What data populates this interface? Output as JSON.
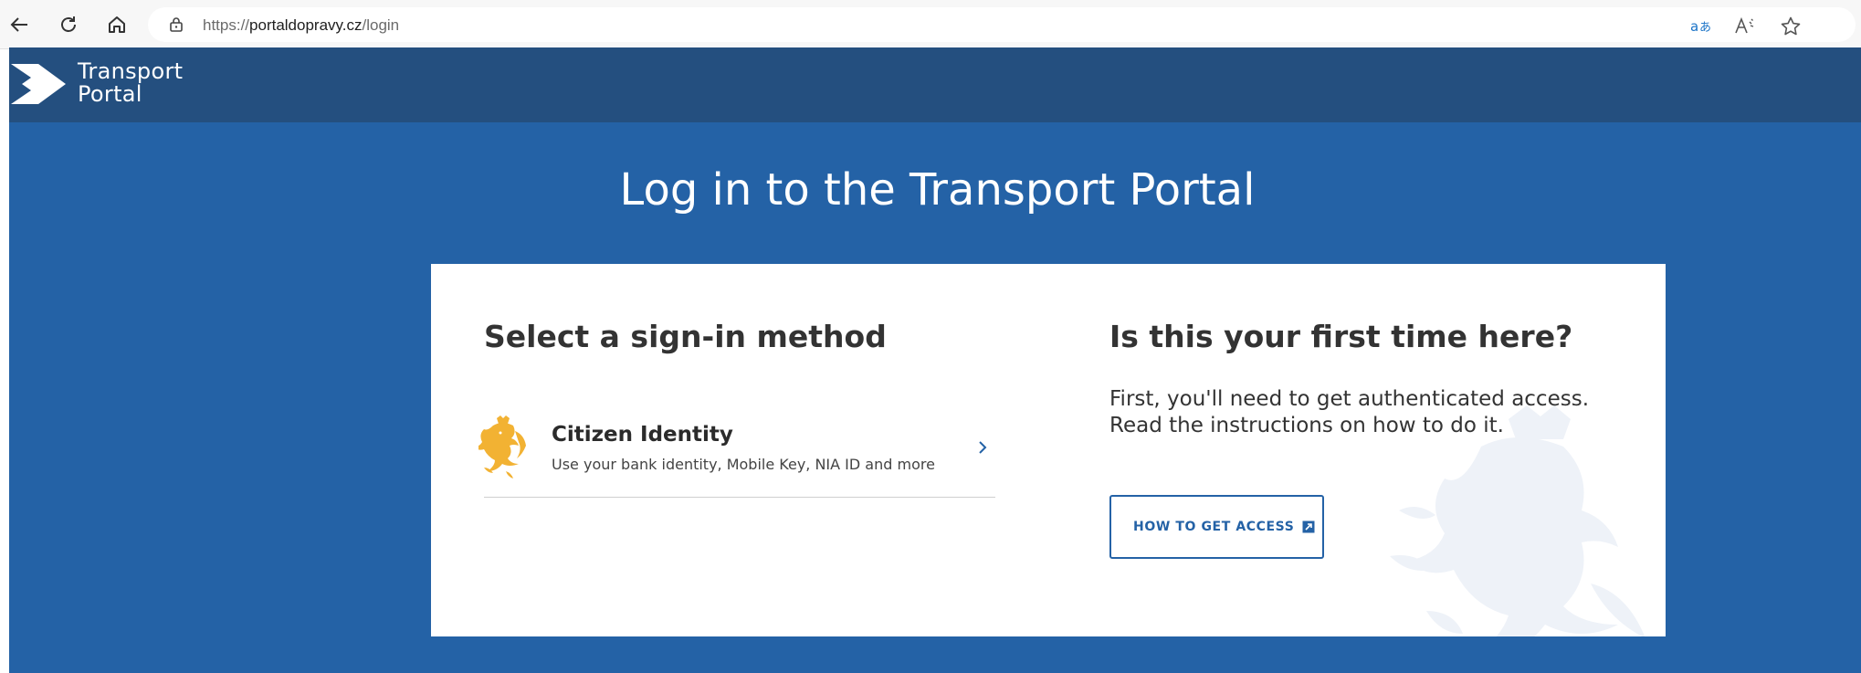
{
  "browser": {
    "url_scheme": "https://",
    "url_host": "portaldopravy.cz",
    "url_path": "/login"
  },
  "header": {
    "logo_line1": "Transport",
    "logo_line2": "Portal"
  },
  "page_title": "Log in to the Transport Portal",
  "sign_in": {
    "title": "Select a sign-in method",
    "methods": [
      {
        "name": "Citizen Identity",
        "description": "Use your bank identity, Mobile Key, NIA ID and more"
      }
    ]
  },
  "first_time": {
    "title": "Is this your first time here?",
    "text": "First, you'll need to get authenticated access. Read the instructions on how to do it.",
    "button_label": "HOW TO GET ACCESS"
  },
  "colors": {
    "header_bg": "#244f7f",
    "page_bg": "#2462a6",
    "accent": "#2462a6",
    "emblem": "#f2b233"
  }
}
